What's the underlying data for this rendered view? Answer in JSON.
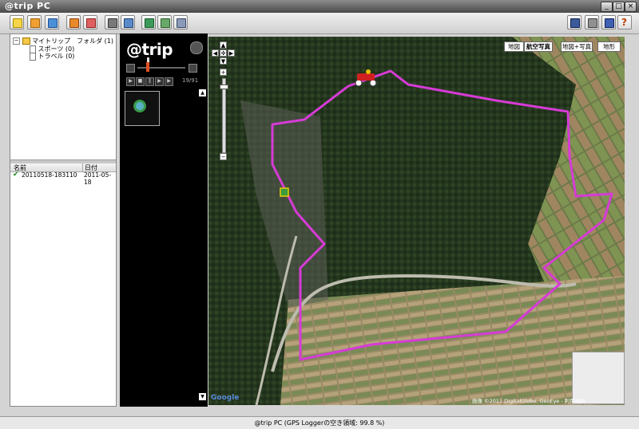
{
  "window": {
    "title": "@trip PC",
    "min": "_",
    "max": "□",
    "close": "×"
  },
  "toolbar": {
    "left_icons": [
      "new-icon",
      "open-folder-icon",
      "import-icon",
      "edit-folder-icon",
      "edit-icon",
      "export-icon",
      "print-icon",
      "photo-icon",
      "save-icon",
      "settings-icon"
    ],
    "right_icons": [
      "gps-device-icon",
      "calculator-icon",
      "display-icon",
      "help-icon"
    ],
    "help_label": "?"
  },
  "tree": {
    "root": "マイトリップ　フォルダ (1)",
    "children": [
      {
        "label": "スポーツ (0)"
      },
      {
        "label": "トラベル (0)"
      }
    ]
  },
  "list": {
    "col_name": "名前",
    "col_date": "日付",
    "rows": [
      {
        "name": "20110518-183110",
        "date": "2011-05-18"
      }
    ]
  },
  "player": {
    "logo": "@trip",
    "counter": "19/91"
  },
  "map": {
    "types": [
      "地図",
      "航空写真",
      "地図+写真",
      "地形"
    ],
    "copyright": "画像 ©2011 DigitalGlobe, GeoEye - 利用規約",
    "google": "Google"
  },
  "statusbar": {
    "text": "@trip PC (GPS Loggerの空き領域: 99.8 %)"
  },
  "colors": {
    "route": "#d63bd6",
    "accent": "#c02020"
  }
}
